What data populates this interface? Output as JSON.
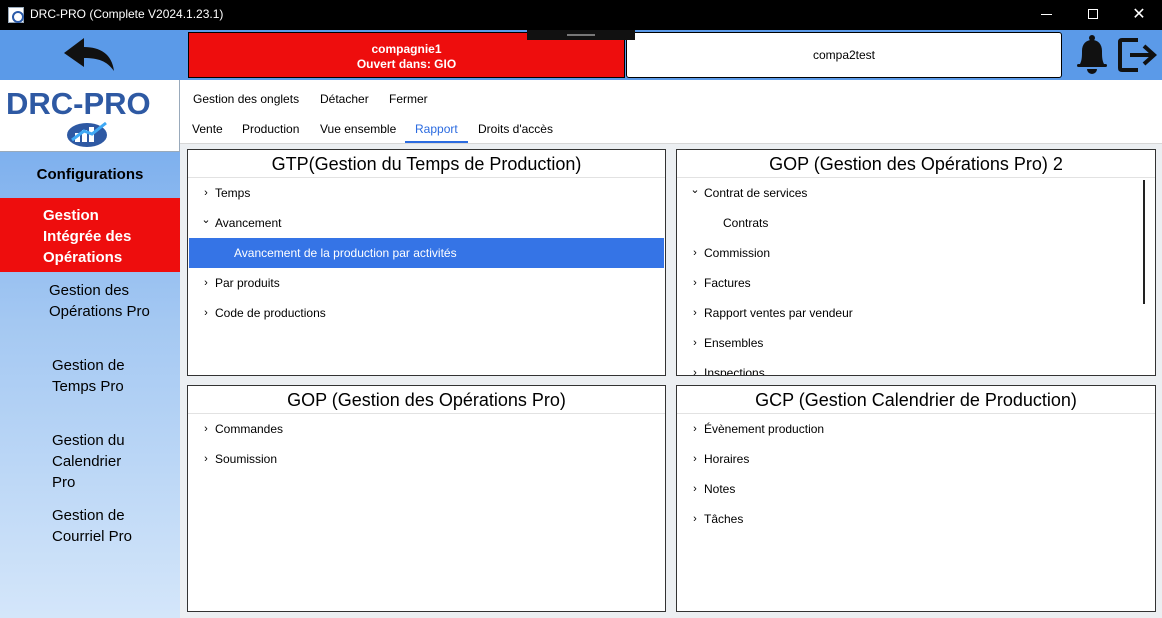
{
  "window": {
    "title": "DRC-PRO (Complete V2024.1.23.1)",
    "minimize_glyph": "—",
    "maximize_glyph": "☐",
    "close_glyph": "✕"
  },
  "topbar": {
    "company_tabs": [
      {
        "name": "compagnie1",
        "subtitle": "Ouvert dans: GIO",
        "color": "#ee0d0d"
      },
      {
        "name": "compa2test"
      }
    ],
    "icons": [
      "back-arrow-icon",
      "bell-icon",
      "logout-icon"
    ]
  },
  "sidebar": {
    "logo_text": "DRC-PRO",
    "section_title": "Configurations",
    "items": [
      {
        "label": "Gestion Intégrée des Opérations",
        "active": true
      },
      {
        "label": "Gestion des Opérations Pro"
      },
      {
        "label": "Gestion de Temps Pro"
      },
      {
        "label": "Gestion du Calendrier Pro"
      },
      {
        "label": "Gestion de Courriel Pro"
      }
    ]
  },
  "menu": {
    "actions": [
      "Gestion des onglets",
      "Détacher",
      "Fermer"
    ],
    "tabs": [
      "Vente",
      "Production",
      "Vue ensemble",
      "Rapport",
      "Droits d'accès"
    ],
    "active_tab": "Rapport"
  },
  "panels": {
    "gtp": {
      "title": "GTP(Gestion du Temps de Production)",
      "items": [
        "Temps",
        "Avancement",
        "Avancement de la production par activités",
        "Par produits",
        "Code de productions"
      ]
    },
    "gop2": {
      "title": "GOP (Gestion des Opérations Pro) 2",
      "items": [
        "Contrat de services",
        "Contrats",
        "Commission",
        "Factures",
        "Rapport ventes par vendeur",
        "Ensembles",
        "Inspections"
      ]
    },
    "gop": {
      "title": "GOP (Gestion des Opérations Pro)",
      "items": [
        "Commandes",
        "Soumission"
      ]
    },
    "gcp": {
      "title": "GCP (Gestion Calendrier de Production)",
      "items": [
        "Évènement production",
        "Horaires",
        "Notes",
        "Tâches"
      ]
    }
  },
  "glyphs": {
    "collapsed": "›",
    "expanded": "⌄"
  },
  "colors": {
    "accent": "#2b6be0",
    "active_red": "#ee0d0d",
    "selected_row": "#3574e6",
    "sidebar_blue": "#5b9ae8"
  }
}
